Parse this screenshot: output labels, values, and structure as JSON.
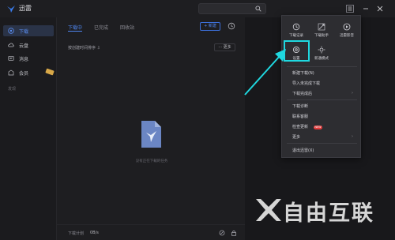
{
  "app": {
    "title": "迅雷"
  },
  "sidebar": {
    "items": [
      {
        "label": "下载",
        "icon": "download-icon"
      },
      {
        "label": "云盘",
        "icon": "cloud-icon"
      },
      {
        "label": "消息",
        "icon": "message-icon"
      },
      {
        "label": "会员",
        "icon": "vip-icon"
      }
    ],
    "section_label": "发现"
  },
  "tabs": [
    {
      "label": "下载中"
    },
    {
      "label": "已完成"
    },
    {
      "label": "回收站"
    }
  ],
  "toolbar": {
    "new_label": "+ 新建"
  },
  "list": {
    "sort_text": "按创建时间排序 ⇩",
    "more_label": "··· 更多"
  },
  "empty": {
    "text": "没有正在下载的任务"
  },
  "bottom": {
    "plan_label": "下载计划",
    "plan_value": "0B/s"
  },
  "menu": {
    "icon_items": [
      {
        "label": "下载记录",
        "icon": "history-icon"
      },
      {
        "label": "下载助手",
        "icon": "assistant-icon"
      },
      {
        "label": "迅雷影音",
        "icon": "player-icon"
      },
      {
        "label": "设置",
        "icon": "settings-gear-icon"
      },
      {
        "label": "新通模式",
        "icon": "mode-icon"
      }
    ],
    "items": [
      {
        "label": "新建下载(N)",
        "submenu": false
      },
      {
        "label": "导入未完成下载",
        "submenu": false
      },
      {
        "label": "下载完成后",
        "submenu": true
      },
      {
        "label": "下载诊断",
        "submenu": false
      },
      {
        "label": "联系客服",
        "submenu": false
      },
      {
        "label": "检查更新",
        "submenu": false,
        "badge": "NEW"
      },
      {
        "label": "更多",
        "submenu": true
      },
      {
        "label": "退出迅雷(X)",
        "submenu": false
      }
    ]
  },
  "colors": {
    "accent": "#4f86f0",
    "highlight": "#1fd8e0"
  },
  "watermark": {
    "text": "自由互联"
  }
}
